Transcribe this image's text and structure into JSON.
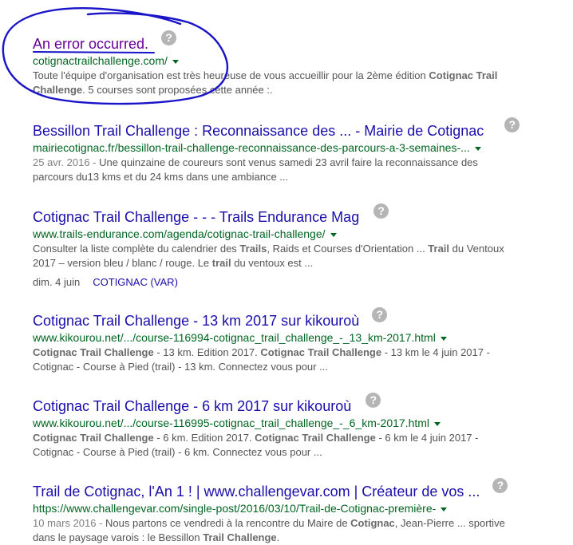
{
  "results": [
    {
      "title": "An error occurred.",
      "url": "cotignactrailchallenge.com/",
      "snippet": [
        {
          "t": "Toute l'équipe d'organisation est très heureuse de vous accueillir pour la 2ème édition "
        },
        {
          "t": "Cotignac Trail",
          "b": true
        },
        {
          "t": " "
        },
        {
          "t": "Challenge",
          "b": true
        },
        {
          "t": ". 5 courses sont proposées cette année :."
        }
      ]
    },
    {
      "title": "Bessillon Trail Challenge : Reconnaissance des ... - Mairie de Cotignac",
      "url": "mairiecotignac.fr/bessillon-trail-challenge-reconnaissance-des-parcours-a-3-semaines-...",
      "date": "25 avr. 2016 - ",
      "snippet": [
        {
          "t": "Une quinzaine de coureurs sont venus samedi 23 avril faire la reconnaissance des parcours du13 kms et du 24 kms dans une ambiance ..."
        }
      ]
    },
    {
      "title": "Cotignac Trail Challenge",
      "title_suffix": " - - - Trails Endurance Mag",
      "url": "www.trails-endurance.com/agenda/cotignac-trail-challenge/",
      "snippet": [
        {
          "t": "Consulter la liste complète du calendrier des "
        },
        {
          "t": "Trails",
          "b": true
        },
        {
          "t": ", Raids et Courses d'Orientation ... "
        },
        {
          "t": "Trail",
          "b": true
        },
        {
          "t": " du Ventoux 2017 – version bleu / blanc / rouge. Le "
        },
        {
          "t": "trail",
          "b": true
        },
        {
          "t": " du ventoux est ..."
        }
      ],
      "meta_date": "dim. 4 juin",
      "meta_location": "COTIGNAC (VAR)"
    },
    {
      "title": "Cotignac Trail Challenge",
      "title_suffix": " - 13 km 2017 sur kikouroù",
      "url": "www.kikourou.net/.../course-116994-cotignac_trail_challenge_-_13_km-2017.html",
      "snippet": [
        {
          "t": "Cotignac Trail Challenge",
          "b": true
        },
        {
          "t": " - 13 km. Edition 2017. "
        },
        {
          "t": "Cotignac Trail Challenge",
          "b": true
        },
        {
          "t": " - 13 km le 4 juin 2017 - Cotignac - Course à Pied (trail) - 13 km. Connectez vous pour ..."
        }
      ]
    },
    {
      "title": "Cotignac Trail Challenge",
      "title_suffix": " - 6 km 2017 sur kikouroù",
      "url": "www.kikourou.net/.../course-116995-cotignac_trail_challenge_-_6_km-2017.html",
      "snippet": [
        {
          "t": "Cotignac Trail Challenge",
          "b": true
        },
        {
          "t": " - 6 km. Edition 2017. "
        },
        {
          "t": "Cotignac Trail Challenge",
          "b": true
        },
        {
          "t": " - 6 km le 4 juin 2017 - Cotignac - Course à Pied (trail) - 6 km. Connectez vous pour ..."
        }
      ]
    },
    {
      "title": "Trail de Cotignac, l'An 1 ! | www.challengevar.com | Créateur de vos ...",
      "url": "https://www.challengevar.com/single-post/2016/03/10/Trail-de-Cotignac-première-",
      "date": "10 mars 2016 - ",
      "snippet": [
        {
          "t": "Nous partons ce vendredi à la rencontre du Maire de "
        },
        {
          "t": "Cotignac",
          "b": true
        },
        {
          "t": ", Jean-Pierre ... sportive dans le paysage varois : le Bessillon "
        },
        {
          "t": "Trail Challenge",
          "b": true
        },
        {
          "t": "."
        }
      ]
    }
  ],
  "help_glyph": "?",
  "icons": {
    "help": "question-circle-icon",
    "dropdown": "caret-down-icon"
  },
  "colors": {
    "title": "#1a0dab",
    "visited": "#660099",
    "url": "#006621",
    "annotation": "#1a14c8"
  }
}
